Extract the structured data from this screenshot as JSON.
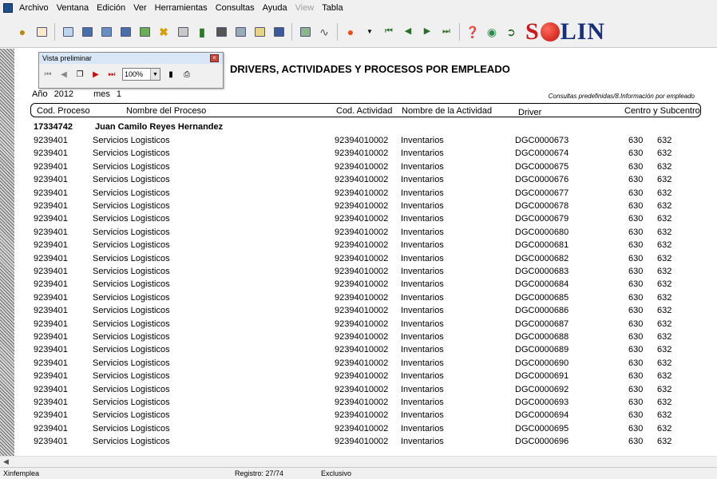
{
  "menu": [
    "Archivo",
    "Ventana",
    "Edición",
    "Ver",
    "Herramientas",
    "Consultas",
    "Ayuda",
    "View",
    "Tabla"
  ],
  "logo": {
    "brand": "SOLIN",
    "s": "S",
    "rest": "LIN"
  },
  "preview": {
    "title": "Vista preliminar",
    "zoom": "100%"
  },
  "report": {
    "title": "DRIVERS, ACTIVIDADES Y PROCESOS POR EMPLEADO",
    "year_label": "Año",
    "year": "2012",
    "month_label": "mes",
    "month": "1",
    "path": "Consultas predefinidas/8.Información por empleado",
    "headers": {
      "cod_proceso": "Cod. Proceso",
      "nombre_proceso": "Nombre del Proceso",
      "cod_actividad": "Cod. Actividad",
      "nombre_actividad": "Nombre de la Actividad",
      "driver": "Driver",
      "centro": "Centro y Subcentro"
    },
    "employee": {
      "id": "17334742",
      "name": "Juan Camilo Reyes Hernandez"
    },
    "rows": [
      {
        "p": "9239401",
        "np": "Servicios Logisticos",
        "a": "92394010002",
        "na": "Inventarios",
        "d": "DGC0000673",
        "c": "630",
        "s": "632"
      },
      {
        "p": "9239401",
        "np": "Servicios Logisticos",
        "a": "92394010002",
        "na": "Inventarios",
        "d": "DGC0000674",
        "c": "630",
        "s": "632"
      },
      {
        "p": "9239401",
        "np": "Servicios Logisticos",
        "a": "92394010002",
        "na": "Inventarios",
        "d": "DGC0000675",
        "c": "630",
        "s": "632"
      },
      {
        "p": "9239401",
        "np": "Servicios Logisticos",
        "a": "92394010002",
        "na": "Inventarios",
        "d": "DGC0000676",
        "c": "630",
        "s": "632"
      },
      {
        "p": "9239401",
        "np": "Servicios Logisticos",
        "a": "92394010002",
        "na": "Inventarios",
        "d": "DGC0000677",
        "c": "630",
        "s": "632"
      },
      {
        "p": "9239401",
        "np": "Servicios Logisticos",
        "a": "92394010002",
        "na": "Inventarios",
        "d": "DGC0000678",
        "c": "630",
        "s": "632"
      },
      {
        "p": "9239401",
        "np": "Servicios Logisticos",
        "a": "92394010002",
        "na": "Inventarios",
        "d": "DGC0000679",
        "c": "630",
        "s": "632"
      },
      {
        "p": "9239401",
        "np": "Servicios Logisticos",
        "a": "92394010002",
        "na": "Inventarios",
        "d": "DGC0000680",
        "c": "630",
        "s": "632"
      },
      {
        "p": "9239401",
        "np": "Servicios Logisticos",
        "a": "92394010002",
        "na": "Inventarios",
        "d": "DGC0000681",
        "c": "630",
        "s": "632"
      },
      {
        "p": "9239401",
        "np": "Servicios Logisticos",
        "a": "92394010002",
        "na": "Inventarios",
        "d": "DGC0000682",
        "c": "630",
        "s": "632"
      },
      {
        "p": "9239401",
        "np": "Servicios Logisticos",
        "a": "92394010002",
        "na": "Inventarios",
        "d": "DGC0000683",
        "c": "630",
        "s": "632"
      },
      {
        "p": "9239401",
        "np": "Servicios Logisticos",
        "a": "92394010002",
        "na": "Inventarios",
        "d": "DGC0000684",
        "c": "630",
        "s": "632"
      },
      {
        "p": "9239401",
        "np": "Servicios Logisticos",
        "a": "92394010002",
        "na": "Inventarios",
        "d": "DGC0000685",
        "c": "630",
        "s": "632"
      },
      {
        "p": "9239401",
        "np": "Servicios Logisticos",
        "a": "92394010002",
        "na": "Inventarios",
        "d": "DGC0000686",
        "c": "630",
        "s": "632"
      },
      {
        "p": "9239401",
        "np": "Servicios Logisticos",
        "a": "92394010002",
        "na": "Inventarios",
        "d": "DGC0000687",
        "c": "630",
        "s": "632"
      },
      {
        "p": "9239401",
        "np": "Servicios Logisticos",
        "a": "92394010002",
        "na": "Inventarios",
        "d": "DGC0000688",
        "c": "630",
        "s": "632"
      },
      {
        "p": "9239401",
        "np": "Servicios Logisticos",
        "a": "92394010002",
        "na": "Inventarios",
        "d": "DGC0000689",
        "c": "630",
        "s": "632"
      },
      {
        "p": "9239401",
        "np": "Servicios Logisticos",
        "a": "92394010002",
        "na": "Inventarios",
        "d": "DGC0000690",
        "c": "630",
        "s": "632"
      },
      {
        "p": "9239401",
        "np": "Servicios Logisticos",
        "a": "92394010002",
        "na": "Inventarios",
        "d": "DGC0000691",
        "c": "630",
        "s": "632"
      },
      {
        "p": "9239401",
        "np": "Servicios Logisticos",
        "a": "92394010002",
        "na": "Inventarios",
        "d": "DGC0000692",
        "c": "630",
        "s": "632"
      },
      {
        "p": "9239401",
        "np": "Servicios Logisticos",
        "a": "92394010002",
        "na": "Inventarios",
        "d": "DGC0000693",
        "c": "630",
        "s": "632"
      },
      {
        "p": "9239401",
        "np": "Servicios Logisticos",
        "a": "92394010002",
        "na": "Inventarios",
        "d": "DGC0000694",
        "c": "630",
        "s": "632"
      },
      {
        "p": "9239401",
        "np": "Servicios Logisticos",
        "a": "92394010002",
        "na": "Inventarios",
        "d": "DGC0000695",
        "c": "630",
        "s": "632"
      },
      {
        "p": "9239401",
        "np": "Servicios Logisticos",
        "a": "92394010002",
        "na": "Inventarios",
        "d": "DGC0000696",
        "c": "630",
        "s": "632"
      }
    ]
  },
  "status": {
    "form": "Xinfemplea",
    "record": "Registro: 27/74",
    "mode": "Exclusivo"
  }
}
